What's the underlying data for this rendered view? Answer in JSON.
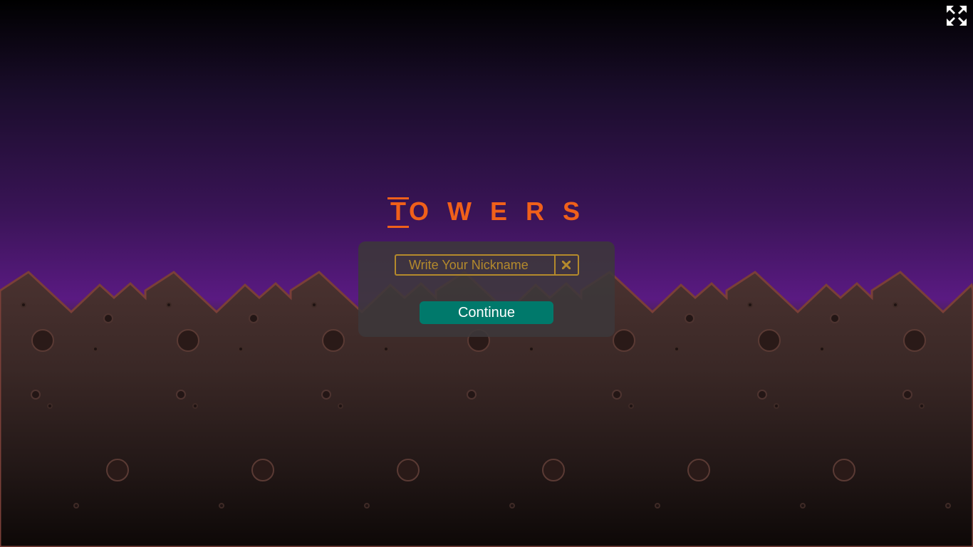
{
  "game": {
    "title_first_letter": "T",
    "title_rest": [
      "O",
      "W",
      "E",
      "R",
      "S"
    ],
    "accent_color": "#f0601a"
  },
  "login_panel": {
    "nickname_placeholder": "Write Your Nickname",
    "nickname_value": "",
    "clear_icon": "close-icon",
    "continue_label": "Continue",
    "continue_color": "#00796b"
  },
  "controls": {
    "fullscreen_icon": "fullscreen-expand-icon"
  }
}
